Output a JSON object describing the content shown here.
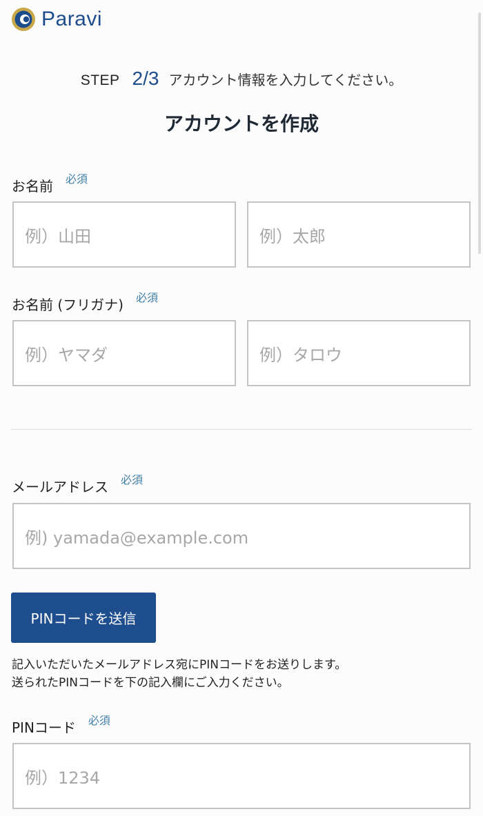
{
  "header": {
    "logo_text": "Paravi"
  },
  "step": {
    "label": "STEP",
    "number": "2/3",
    "text": "アカウント情報を入力してください。"
  },
  "title": "アカウントを作成",
  "required_label": "必須",
  "name": {
    "label": "お名前",
    "last_placeholder": "例）山田",
    "first_placeholder": "例）太郎"
  },
  "furigana": {
    "label": "お名前 (フリガナ)",
    "last_placeholder": "例）ヤマダ",
    "first_placeholder": "例）タロウ"
  },
  "email": {
    "label": "メールアドレス",
    "placeholder": "例) yamada@example.com"
  },
  "pin_button": "PINコードを送信",
  "note": {
    "line1": "記入いただいたメールアドレス宛にPINコードをお送りします。",
    "line2": "送られたPINコードを下の記入欄にご入力ください。"
  },
  "pin": {
    "label": "PINコード",
    "placeholder": "例）1234"
  },
  "colors": {
    "brand": "#1d4c8c",
    "required": "#3f7fa8",
    "button": "#1f4e8f"
  }
}
